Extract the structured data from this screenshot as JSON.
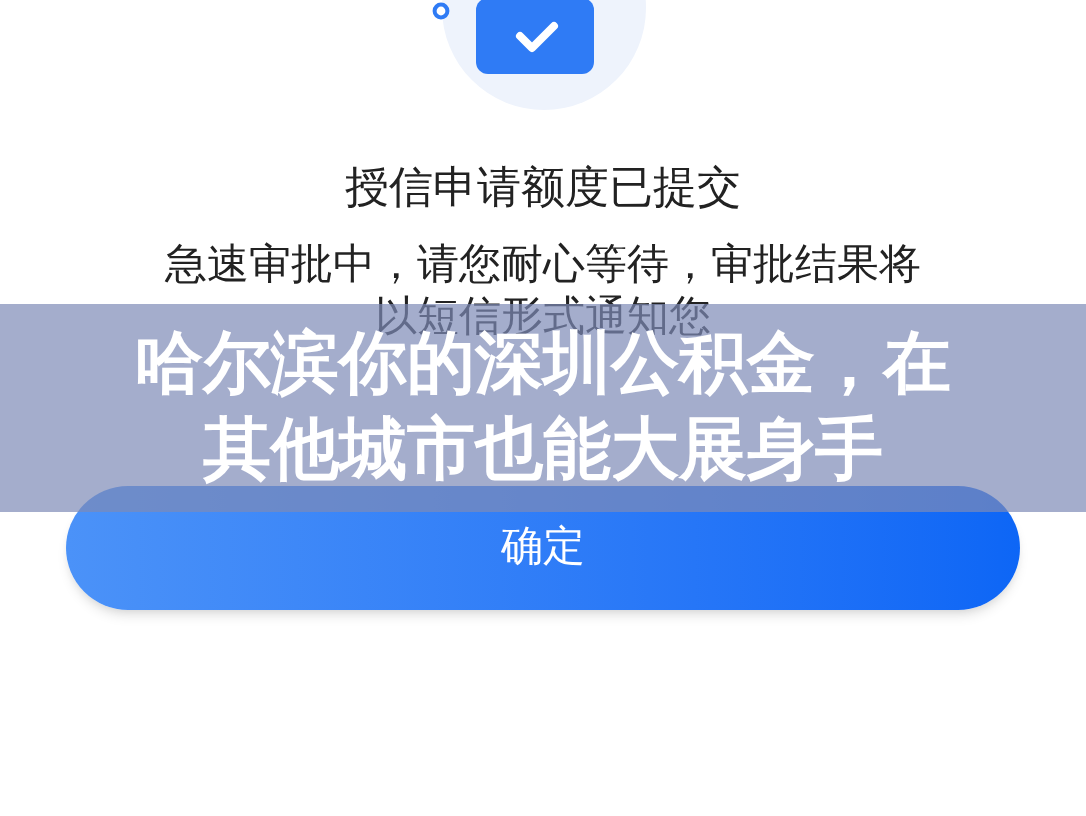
{
  "dialog": {
    "title": "授信申请额度已提交",
    "message": "急速审批中，请您耐心等待，审批结果将以短信形式通知您",
    "button": "确定"
  },
  "banner": {
    "headline": "哈尔滨你的深圳公积金，在其他城市也能大展身手"
  }
}
